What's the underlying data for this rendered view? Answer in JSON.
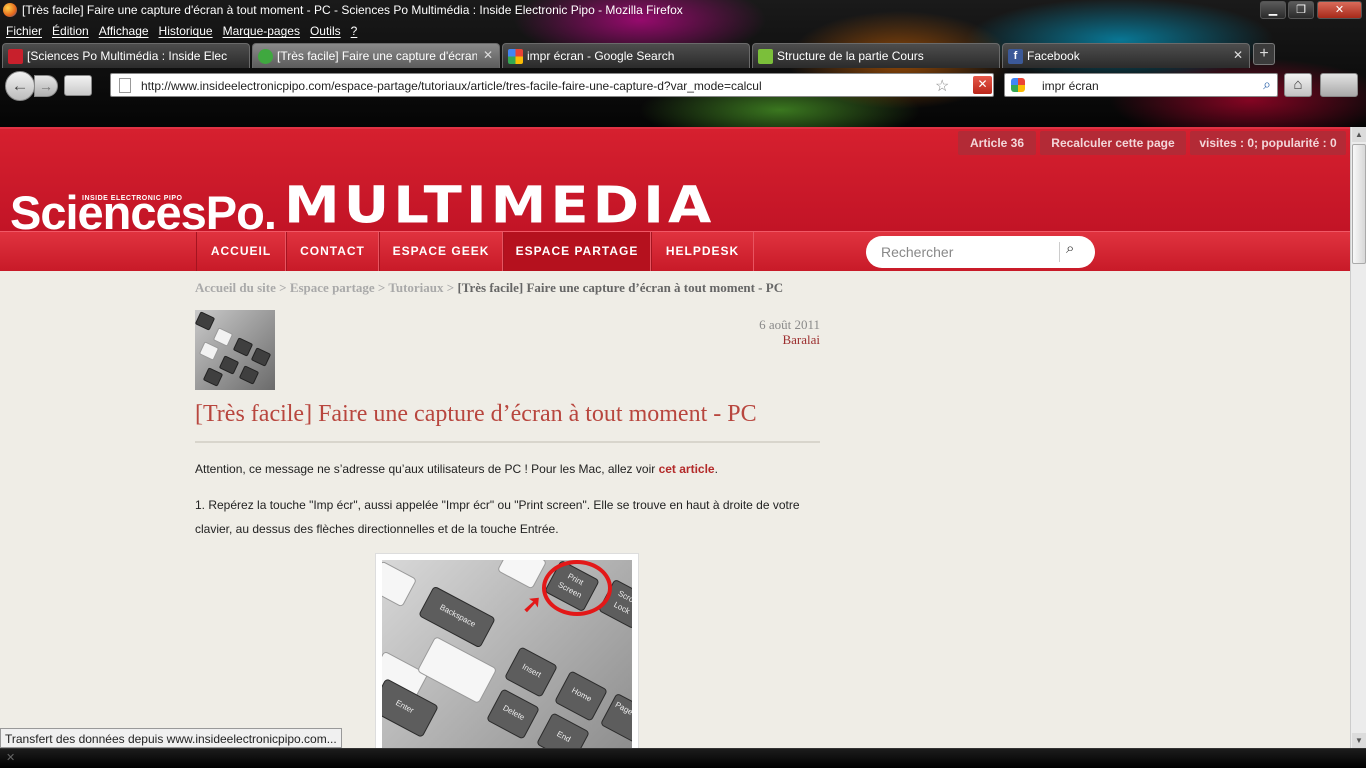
{
  "window": {
    "title": "[Très facile] Faire une capture d'écran à tout moment - PC - Sciences Po Multimédia : Inside Electronic Pipo - Mozilla Firefox",
    "min": "▁",
    "max": "❐",
    "close": "✕"
  },
  "menu": [
    "Fichier",
    "Édition",
    "Affichage",
    "Historique",
    "Marque-pages",
    "Outils",
    "?"
  ],
  "tabs": [
    {
      "label": "[Sciences Po Multimédia : Inside Elect...",
      "color": "#c8202c"
    },
    {
      "label": "[Très facile] Faire une capture d'écran...",
      "color": "#3fa83f"
    },
    {
      "label": "impr écran - Google Search",
      "color": "#4285f4"
    },
    {
      "label": "Structure de la partie Cours",
      "color": "#7bbf3a"
    },
    {
      "label": "Facebook",
      "color": "#3b5998"
    }
  ],
  "newtab": "+",
  "nav": {
    "back": "←",
    "forward": "→",
    "url": "http://www.insideelectronicpipo.com/espace-partage/tutoriaux/article/tres-facile-faire-une-capture-d?var_mode=calcul",
    "star": "☆",
    "stop": "✕",
    "search_query": "impr écran",
    "search_icon": "⌕",
    "home_icon": "⌂"
  },
  "site": {
    "pills": [
      "Article 36",
      "Recalculer cette page",
      "visites : 0; popularité : 0"
    ],
    "logo_sp": "SciencesPo.",
    "logo_tag": "INSIDE ELECTRONIC PIPO",
    "logo_mm": "MULTIMEDIA",
    "nav_items": [
      "ACCUEIL",
      "CONTACT",
      "ESPACE GEEK",
      "ESPACE PARTAGE",
      "HELPDESK"
    ],
    "search_placeholder": "Rechercher",
    "search_icon": "⌕"
  },
  "breadcrumb": {
    "home": "Accueil du site",
    "sep": " > ",
    "section": "Espace partage",
    "sub": "Tutoriaux",
    "current": "[Très facile] Faire une capture d’écran à tout moment - PC"
  },
  "article": {
    "date": "6 août 2011",
    "author": "Baralai",
    "title": "[Très facile] Faire une capture d’écran à tout moment - PC",
    "intro_before": "Attention, ce message ne s’adresse qu’aux utilisateurs de PC ! Pour les Mac, allez voir ",
    "intro_link": "cet article",
    "intro_after": ".",
    "step1": "1. Repérez la touche \"Imp écr\", aussi appelée \"Impr écr\" ou \"Print screen\". Elle se trouve en haut à droite de votre clavier, au dessus des flèches directionnelles et de la touche Entrée.",
    "keys": [
      "Print Screen",
      "Backspace",
      "Insert",
      "Home",
      "Delete",
      "End",
      "Page Up",
      "Enter",
      "Scroll Lock"
    ]
  },
  "status": "Transfert des données depuis www.insideelectronicpipo.com..."
}
